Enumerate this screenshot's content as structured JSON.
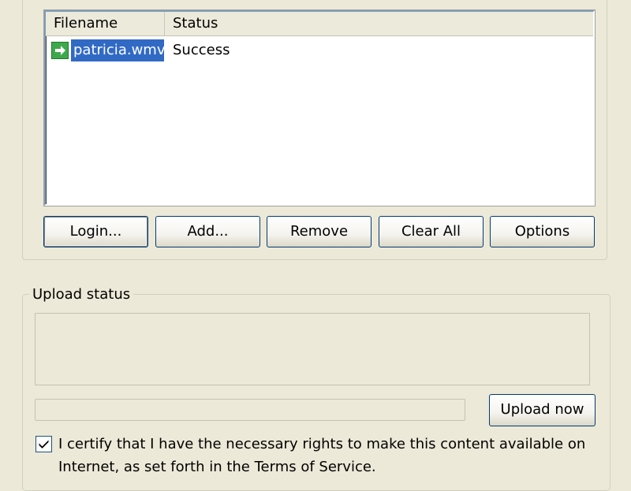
{
  "file_list": {
    "columns": [
      "Filename",
      "Status"
    ],
    "rows": [
      {
        "icon": "green-arrow-right-icon",
        "filename": "patricia.wmv",
        "status": "Success"
      }
    ]
  },
  "buttons": {
    "login": "Login...",
    "add": "Add...",
    "remove": "Remove",
    "clear_all": "Clear All",
    "options": "Options"
  },
  "upload_status": {
    "legend": "Upload status",
    "status_text": "",
    "progress": 0,
    "upload_button": "Upload now"
  },
  "certify": {
    "checked": true,
    "label": "I certify that I have the necessary rights to make this content available on Internet, as set forth in the Terms of Service."
  },
  "colors": {
    "selection": "#316ac5",
    "button_border": "#003c74",
    "window_bg": "#ece9d8"
  }
}
